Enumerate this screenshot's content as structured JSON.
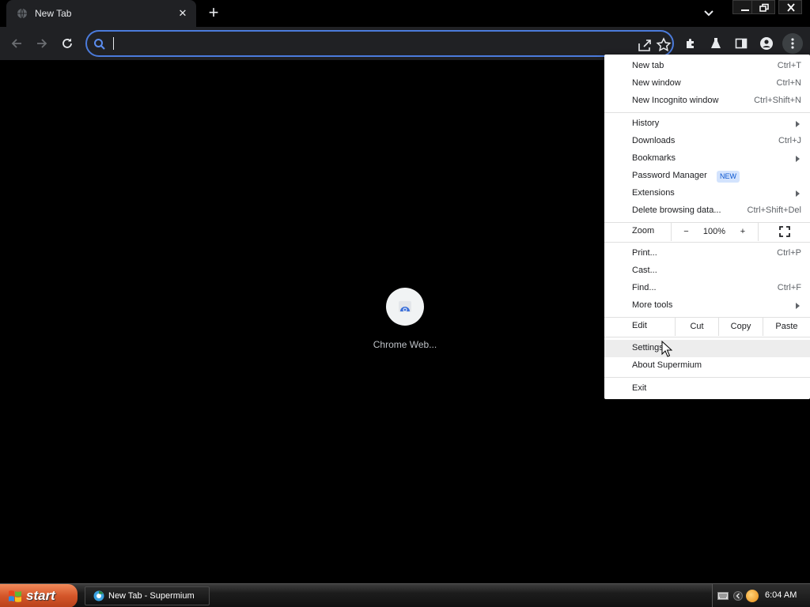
{
  "browser": {
    "tab": {
      "title": "New Tab",
      "close_symbol": "✕"
    },
    "new_tab_symbol": "+",
    "omnibox": {
      "value": "",
      "placeholder": ""
    }
  },
  "content": {
    "shortcut": {
      "label": "Chrome Web..."
    }
  },
  "menu": {
    "items_top": [
      {
        "label": "New tab",
        "shortcut": "Ctrl+T"
      },
      {
        "label": "New window",
        "shortcut": "Ctrl+N"
      },
      {
        "label": "New Incognito window",
        "shortcut": "Ctrl+Shift+N"
      }
    ],
    "items_mid": [
      {
        "label": "History",
        "shortcut": ""
      },
      {
        "label": "Downloads",
        "shortcut": "Ctrl+J"
      },
      {
        "label": "Bookmarks",
        "shortcut": ""
      },
      {
        "label": "Password Manager",
        "shortcut": "",
        "badge": "NEW"
      },
      {
        "label": "Extensions",
        "shortcut": ""
      },
      {
        "label": "Delete browsing data...",
        "shortcut": "Ctrl+Shift+Del"
      }
    ],
    "zoom": {
      "label": "Zoom",
      "minus": "−",
      "value": "100%",
      "plus": "+"
    },
    "items_tools": [
      {
        "label": "Print...",
        "shortcut": "Ctrl+P"
      },
      {
        "label": "Cast...",
        "shortcut": ""
      },
      {
        "label": "Find...",
        "shortcut": "Ctrl+F"
      },
      {
        "label": "More tools",
        "shortcut": ""
      }
    ],
    "edit": {
      "label": "Edit",
      "cut": "Cut",
      "copy": "Copy",
      "paste": "Paste"
    },
    "items_bottom": [
      {
        "label": "Settings"
      },
      {
        "label": "About Supermium"
      }
    ],
    "exit": {
      "label": "Exit"
    }
  },
  "taskbar": {
    "start_label": "start",
    "task_title": "New Tab - Supermium",
    "clock": "6:04 AM"
  },
  "colors": {
    "omnibox_border": "#4b7bdb",
    "start_button": "#d4562a",
    "badge_bg": "#d3e3fd",
    "badge_text": "#0b57d0"
  }
}
